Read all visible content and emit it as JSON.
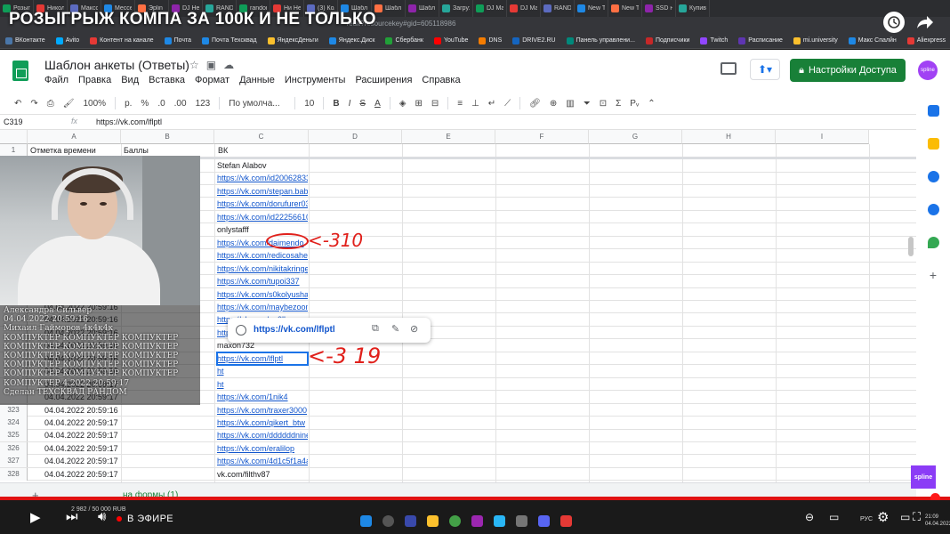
{
  "stream": {
    "title": "РОЗЫГРЫЖ КОМПА ЗА 100К И НЕ ТОЛЬКО",
    "live_label": "В ЭФИРЕ",
    "donation": "2 982 / 50 000 RUB"
  },
  "browser": {
    "tabs": [
      "Розыг",
      "Никол",
      "Максс",
      "Мессе",
      "Эрlin",
      "DJ Не",
      "RAND",
      "randor",
      "Ни Не",
      "(3) Кол",
      "Шабл",
      "Шабл",
      "Шабл",
      "Загруз",
      "DJ Ма",
      "DJ Ма",
      "RAND",
      "New T",
      "New T",
      "SSD н",
      "Купив"
    ],
    "url": "/edit?resourcekey#gid=605118986",
    "bookmarks": [
      "ВКонтакте",
      "Avito",
      "Контент на канале",
      "Почта",
      "Почта Техсквад",
      "ЯндексДеньги",
      "Яндекс.Диск",
      "Сбербанк",
      "YouTube",
      "DNS",
      "DRIVE2.RU",
      "Панель управлени...",
      "Подписчики",
      "Twitch",
      "Расписание",
      "mi.university",
      "Макс Спалйн",
      "Aliexpress"
    ]
  },
  "sheets": {
    "doc_title": "Шаблон анкеты (Ответы)",
    "menu": [
      "Файл",
      "Правка",
      "Вид",
      "Вставка",
      "Формат",
      "Данные",
      "Инструменты",
      "Расширения",
      "Справка"
    ],
    "share_label": "Настройки Доступа",
    "avatar_text": "spline",
    "toolbar": {
      "zoom": "100%",
      "currency": "р.",
      "percent": "%",
      "dec_minus": ".0",
      "dec_plus": ".00",
      "format_123": "123",
      "font": "По умолча...",
      "font_size": "10",
      "bold": "B",
      "italic": "I",
      "strike": "S",
      "text_color": "A"
    },
    "name_box": "C319",
    "fx": "fx",
    "formula": "https://vk.com/lflptl",
    "columns": [
      "A",
      "B",
      "C",
      "D",
      "E",
      "F",
      "G",
      "H",
      "I"
    ],
    "header_row": {
      "num": "1",
      "a": "Отметка времени",
      "b": "Баллы",
      "c": "ВК"
    },
    "rows": [
      {
        "num": "",
        "a": "",
        "c": "Stefan Alabov",
        "link": false
      },
      {
        "num": "",
        "a": "",
        "c": "https://vk.com/id200628330",
        "link": true
      },
      {
        "num": "",
        "a": "",
        "c": "https://vk.com/stepan.babin",
        "link": true
      },
      {
        "num": "",
        "a": "",
        "c": "https://vk.com/dorufurer03",
        "link": true
      },
      {
        "num": "",
        "a": "",
        "c": "https://vk.com/id222566102",
        "link": true
      },
      {
        "num": "",
        "a": "",
        "c": "onlystafff",
        "link": false
      },
      {
        "num": "",
        "a": "",
        "c": "https://vk.com/daimendo",
        "link": true
      },
      {
        "num": "",
        "a": "",
        "c": "https://vk.com/redicosahedron",
        "link": true
      },
      {
        "num": "",
        "a": "",
        "c": "https://vk.com/nikitakringe",
        "link": true
      },
      {
        "num": "",
        "a": "",
        "c": "https://vk.com/tupoi337",
        "link": true
      },
      {
        "num": "",
        "a": "",
        "c": "https://vk.com/s0kolyusha",
        "link": true
      },
      {
        "num": "",
        "a": "04.04.2022 20:59:16",
        "c": "https://vk.com/maybezoom",
        "link": true
      },
      {
        "num": "",
        "a": "04.04.2022 20:59:16",
        "c": "https://vk.com/o_0ll",
        "link": true
      },
      {
        "num": "",
        "a": "04.04.2022 20:59:16",
        "c": "https://vk.com/idvladshum",
        "link": true
      },
      {
        "num": "",
        "a": "04.04.2022 20:59:16",
        "c": "maxon732",
        "link": false
      },
      {
        "num": "",
        "a": "04.04.2022 20:59:16",
        "c": "https://vk.com/lflptl",
        "link": true
      },
      {
        "num": "",
        "a": "04.04.2022 20:59:16",
        "c": "ht",
        "link": true
      },
      {
        "num": "",
        "a": "04.04.2022 20:59:17",
        "c": "ht",
        "link": true
      },
      {
        "num": "",
        "a": "04.04.2022 20:59:17",
        "c": "https://vk.com/1nik4",
        "link": true
      },
      {
        "num": "323",
        "a": "04.04.2022 20:59:16",
        "c": "https://vk.com/traxer3000",
        "link": true
      },
      {
        "num": "324",
        "a": "04.04.2022 20:59:17",
        "c": "https://vk.com/qikert_btw",
        "link": true
      },
      {
        "num": "325",
        "a": "04.04.2022 20:59:17",
        "c": "https://vk.com/ddddddninee",
        "link": true
      },
      {
        "num": "326",
        "a": "04.04.2022 20:59:17",
        "c": "https://vk.com/eralilop",
        "link": true
      },
      {
        "num": "327",
        "a": "04.04.2022 20:59:17",
        "c": "https://vk.com/4d1c5f1a4a575d",
        "link": true
      },
      {
        "num": "328",
        "a": "04.04.2022 20:59:17",
        "c": "vk.com/filthv87",
        "link": false
      }
    ],
    "link_popup": "https://vk.com/lflptl",
    "sheet_tab": "на формы (1)"
  },
  "annotations": {
    "mark_1": "<-310",
    "mark_2": "<-3 19"
  },
  "chat_overlay": [
    "Александра Сильвер",
    "04.04.2022 20:59:16",
    "Михаил Гайморов 4к4к4к",
    "КОМПУКТЕР КОМПУКТЕР КОМПУКТЕР",
    "КОМПУКТЕР КОМПУКТЕР КОМПУКТЕР",
    "КОМПУКТЕР КОМПУКТЕР КОМПУКТЕР",
    "КОМПУКТЕР КОМПУКТЕР КОМПУКТЕР",
    "КОМПУКТЕР КОМПУКТЕР КОМПУКТЕР",
    "КОМПУКТЕР 4.2022 20:59:17",
    "Сделан ТЕХСКВАД РАНДОМ"
  ],
  "system": {
    "lang": "РУС",
    "time": "21:09",
    "date": "04.04.2022"
  },
  "colors": {
    "accent_green": "#188038",
    "link_blue": "#1155cc",
    "annotation_red": "#e0201b",
    "selection_blue": "#1a73e8",
    "progress_red": "#e01212"
  }
}
